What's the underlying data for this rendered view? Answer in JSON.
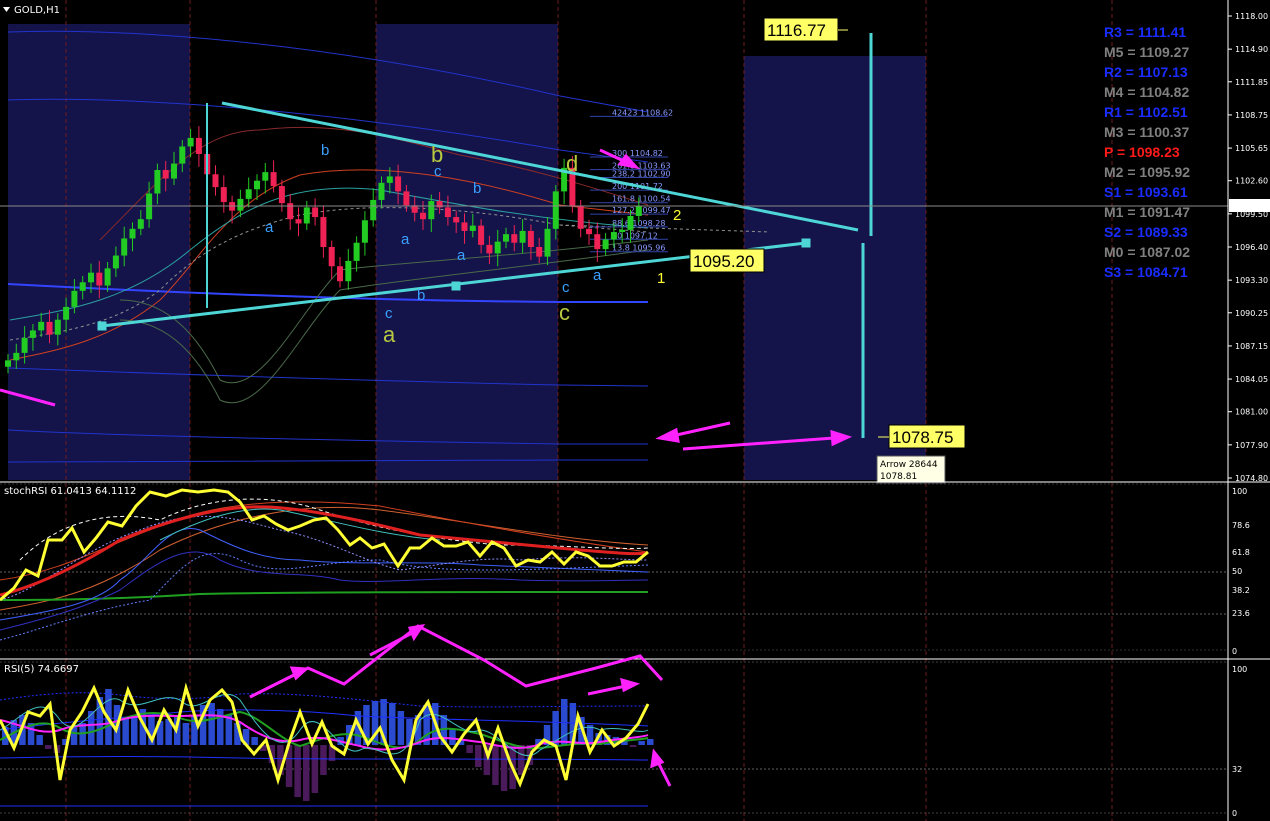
{
  "colors": {
    "bg": "#000000",
    "session_shade": "#14144a",
    "bull": "#22cc22",
    "bear": "#ee2255",
    "trend": "#4ed6d6",
    "magenta": "#ff22ff",
    "yellow": "#ffff33",
    "grid": "#6b1d1d"
  },
  "main": {
    "title": "GOLD,H1",
    "price_axis": [
      "1118.00",
      "1114.90",
      "1111.85",
      "1108.75",
      "1105.65",
      "1102.60",
      "1099.50",
      "1096.40",
      "1093.30",
      "1090.25",
      "1087.15",
      "1084.05",
      "1081.00",
      "1077.90",
      "1074.80"
    ],
    "current_price": "1100.20",
    "box_labels": {
      "upper": "1116.77",
      "mid": "1095.20",
      "lower": "1078.75"
    },
    "tooltip": {
      "line1": "Arrow 28644",
      "line2": "1078.81"
    },
    "fib_levels": [
      "42423 1108.62",
      "300 1104.82",
      "261.8 1103.63",
      "238.2 1102.90",
      "200 1101.72",
      "161.8 1100.54",
      "127.2 1099.47",
      "88.6 1098.28",
      "50 1097.12",
      "13.8 1095.96"
    ],
    "wave_labels": [
      {
        "text": "b",
        "color": "#3aa0ff"
      },
      {
        "text": "a",
        "color": "#3aa0ff"
      },
      {
        "text": "c",
        "color": "#3aa0ff"
      },
      {
        "text": "a",
        "color": "#b8c840"
      },
      {
        "text": "b",
        "color": "#3aa0ff"
      },
      {
        "text": "a",
        "color": "#3aa0ff"
      },
      {
        "text": "b",
        "color": "#b8c840"
      },
      {
        "text": "c",
        "color": "#3aa0ff"
      },
      {
        "text": "b",
        "color": "#3aa0ff"
      },
      {
        "text": "a",
        "color": "#3aa0ff"
      },
      {
        "text": "d",
        "color": "#b8c840"
      },
      {
        "text": "c",
        "color": "#3aa0ff"
      },
      {
        "text": "a",
        "color": "#3aa0ff"
      },
      {
        "text": "c",
        "color": "#b8c840"
      },
      {
        "text": "2",
        "color": "#ffff33"
      },
      {
        "text": "1",
        "color": "#ffff33"
      }
    ],
    "pivots": [
      {
        "text": "R3 = 1111.41",
        "color": "#1a2cff"
      },
      {
        "text": "M5 = 1109.27",
        "color": "#808080"
      },
      {
        "text": "R2 = 1107.13",
        "color": "#1a2cff"
      },
      {
        "text": "M4 = 1104.82",
        "color": "#808080"
      },
      {
        "text": "R1 = 1102.51",
        "color": "#1a2cff"
      },
      {
        "text": "M3 = 1100.37",
        "color": "#808080"
      },
      {
        "text": "P   = 1098.23",
        "color": "#ff1a1a"
      },
      {
        "text": "M2 = 1095.92",
        "color": "#808080"
      },
      {
        "text": "S1 = 1093.61",
        "color": "#1a2cff"
      },
      {
        "text": "M1 = 1091.47",
        "color": "#808080"
      },
      {
        "text": "S2 = 1089.33",
        "color": "#1a2cff"
      },
      {
        "text": "M0 = 1087.02",
        "color": "#808080"
      },
      {
        "text": "S3 = 1084.71",
        "color": "#1a2cff"
      }
    ]
  },
  "stoch_panel": {
    "title": "stochRSI 61.0413 64.1112",
    "axis": [
      "100",
      "78.6",
      "61.8",
      "50",
      "38.2",
      "23.6",
      "0"
    ]
  },
  "rsi_panel": {
    "title": "RSI(5) 74.6697",
    "axis": [
      "100",
      "32",
      "0"
    ]
  },
  "chart_data": {
    "type": "candlestick",
    "title": "GOLD,H1",
    "price_range": [
      1074.8,
      1118.0
    ],
    "closes": [
      1085.8,
      1086.5,
      1087.9,
      1088.6,
      1089.4,
      1088.2,
      1089.6,
      1090.8,
      1092.3,
      1093.1,
      1094.0,
      1092.8,
      1094.4,
      1095.6,
      1097.2,
      1098.1,
      1099.0,
      1101.4,
      1103.6,
      1102.8,
      1104.2,
      1105.8,
      1106.6,
      1105.1,
      1103.2,
      1102.0,
      1100.6,
      1099.8,
      1100.9,
      1101.8,
      1102.6,
      1103.4,
      1102.1,
      1100.5,
      1099.0,
      1098.6,
      1100.1,
      1099.2,
      1096.4,
      1094.6,
      1093.2,
      1095.1,
      1096.8,
      1098.9,
      1100.8,
      1102.4,
      1103.0,
      1101.6,
      1100.3,
      1099.6,
      1099.0,
      1100.7,
      1100.1,
      1099.2,
      1098.7,
      1097.9,
      1098.4,
      1096.6,
      1095.8,
      1096.9,
      1097.6,
      1096.8,
      1097.9,
      1096.4,
      1095.5,
      1098.1,
      1101.6,
      1103.8,
      1100.2,
      1098.1,
      1097.6,
      1096.2,
      1097.1,
      1097.8,
      1098.0,
      1099.3,
      1100.2
    ],
    "stoch_rsi": {
      "k": 61.0413,
      "d": 64.1112
    },
    "rsi5": 74.6697
  }
}
